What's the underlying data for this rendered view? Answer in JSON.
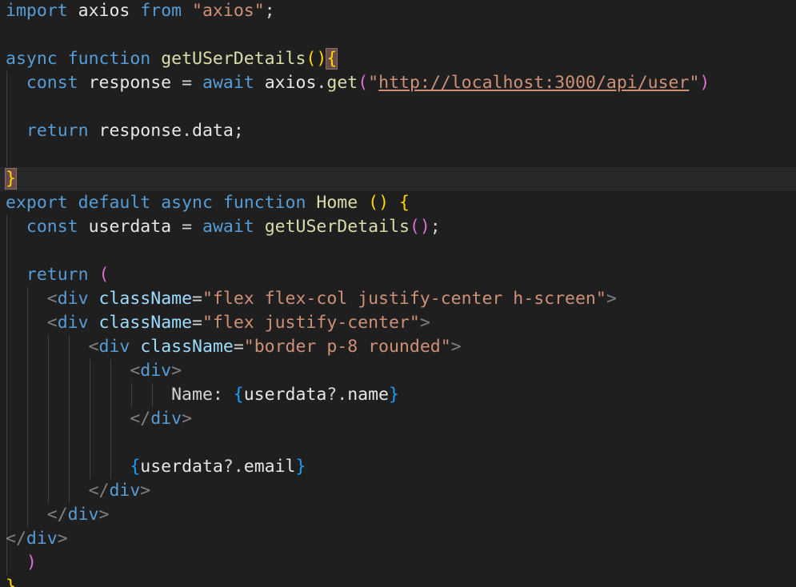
{
  "editor": {
    "lines": [
      [
        {
          "t": "import",
          "c": "kw"
        },
        {
          "t": " "
        },
        {
          "t": "axios",
          "c": "var-white"
        },
        {
          "t": " "
        },
        {
          "t": "from",
          "c": "kw"
        },
        {
          "t": " "
        },
        {
          "t": "\"axios\"",
          "c": "str"
        },
        {
          "t": ";",
          "c": "plain"
        }
      ],
      [],
      [
        {
          "t": "async",
          "c": "kw"
        },
        {
          "t": " "
        },
        {
          "t": "function",
          "c": "kw"
        },
        {
          "t": " "
        },
        {
          "t": "getUSerDetails",
          "c": "fn"
        },
        {
          "t": "()",
          "c": "b1"
        },
        {
          "t": "{",
          "c": "b1 match"
        }
      ],
      [
        {
          "t": "  "
        },
        {
          "t": "const",
          "c": "kw"
        },
        {
          "t": " "
        },
        {
          "t": "response",
          "c": "var-white"
        },
        {
          "t": " "
        },
        {
          "t": "=",
          "c": "plain"
        },
        {
          "t": " "
        },
        {
          "t": "await",
          "c": "kw"
        },
        {
          "t": " "
        },
        {
          "t": "axios",
          "c": "var-white"
        },
        {
          "t": ".",
          "c": "plain"
        },
        {
          "t": "get",
          "c": "fn"
        },
        {
          "t": "(",
          "c": "b2"
        },
        {
          "t": "\"",
          "c": "str"
        },
        {
          "t": "http://localhost:3000/api/user",
          "c": "str link"
        },
        {
          "t": "\"",
          "c": "str"
        },
        {
          "t": ")",
          "c": "b2"
        }
      ],
      [],
      [
        {
          "t": "  "
        },
        {
          "t": "return",
          "c": "kw"
        },
        {
          "t": " "
        },
        {
          "t": "response",
          "c": "var-white"
        },
        {
          "t": ".",
          "c": "plain"
        },
        {
          "t": "data",
          "c": "var-white"
        },
        {
          "t": ";",
          "c": "plain"
        }
      ],
      [],
      [
        {
          "t": "}",
          "c": "b1 match"
        }
      ],
      [
        {
          "t": "export",
          "c": "kw"
        },
        {
          "t": " "
        },
        {
          "t": "default",
          "c": "kw"
        },
        {
          "t": " "
        },
        {
          "t": "async",
          "c": "kw"
        },
        {
          "t": " "
        },
        {
          "t": "function",
          "c": "kw"
        },
        {
          "t": " "
        },
        {
          "t": "Home",
          "c": "fn"
        },
        {
          "t": " "
        },
        {
          "t": "()",
          "c": "b1"
        },
        {
          "t": " "
        },
        {
          "t": "{",
          "c": "b1"
        }
      ],
      [
        {
          "t": "  "
        },
        {
          "t": "const",
          "c": "kw"
        },
        {
          "t": " "
        },
        {
          "t": "userdata",
          "c": "var-white"
        },
        {
          "t": " "
        },
        {
          "t": "=",
          "c": "plain"
        },
        {
          "t": " "
        },
        {
          "t": "await",
          "c": "kw"
        },
        {
          "t": " "
        },
        {
          "t": "getUSerDetails",
          "c": "fn"
        },
        {
          "t": "()",
          "c": "b2"
        },
        {
          "t": ";",
          "c": "plain"
        }
      ],
      [],
      [
        {
          "t": "  "
        },
        {
          "t": "return",
          "c": "kw"
        },
        {
          "t": " "
        },
        {
          "t": "(",
          "c": "b2"
        }
      ],
      [
        {
          "t": "    "
        },
        {
          "t": "<",
          "c": "punc"
        },
        {
          "t": "div",
          "c": "tag"
        },
        {
          "t": " "
        },
        {
          "t": "className",
          "c": "attr"
        },
        {
          "t": "=",
          "c": "plain"
        },
        {
          "t": "\"flex flex-col justify-center h-screen\"",
          "c": "str"
        },
        {
          "t": ">",
          "c": "punc"
        }
      ],
      [
        {
          "t": "    "
        },
        {
          "t": "<",
          "c": "punc"
        },
        {
          "t": "div",
          "c": "tag"
        },
        {
          "t": " "
        },
        {
          "t": "className",
          "c": "attr"
        },
        {
          "t": "=",
          "c": "plain"
        },
        {
          "t": "\"flex justify-center\"",
          "c": "str"
        },
        {
          "t": ">",
          "c": "punc"
        }
      ],
      [
        {
          "t": "        "
        },
        {
          "t": "<",
          "c": "punc"
        },
        {
          "t": "div",
          "c": "tag"
        },
        {
          "t": " "
        },
        {
          "t": "className",
          "c": "attr"
        },
        {
          "t": "=",
          "c": "plain"
        },
        {
          "t": "\"border p-8 rounded\"",
          "c": "str"
        },
        {
          "t": ">",
          "c": "punc"
        }
      ],
      [
        {
          "t": "            "
        },
        {
          "t": "<",
          "c": "punc"
        },
        {
          "t": "div",
          "c": "tag"
        },
        {
          "t": ">",
          "c": "punc"
        }
      ],
      [
        {
          "t": "                "
        },
        {
          "t": "Name: ",
          "c": "jsx-text"
        },
        {
          "t": "{",
          "c": "b3"
        },
        {
          "t": "userdata",
          "c": "var-white"
        },
        {
          "t": "?.",
          "c": "plain"
        },
        {
          "t": "name",
          "c": "var-white"
        },
        {
          "t": "}",
          "c": "b3"
        }
      ],
      [
        {
          "t": "            "
        },
        {
          "t": "</",
          "c": "punc"
        },
        {
          "t": "div",
          "c": "tag"
        },
        {
          "t": ">",
          "c": "punc"
        }
      ],
      [],
      [
        {
          "t": "            "
        },
        {
          "t": "{",
          "c": "b3"
        },
        {
          "t": "userdata",
          "c": "var-white"
        },
        {
          "t": "?.",
          "c": "plain"
        },
        {
          "t": "email",
          "c": "var-white"
        },
        {
          "t": "}",
          "c": "b3"
        }
      ],
      [
        {
          "t": "        "
        },
        {
          "t": "</",
          "c": "punc"
        },
        {
          "t": "div",
          "c": "tag"
        },
        {
          "t": ">",
          "c": "punc"
        }
      ],
      [
        {
          "t": "    "
        },
        {
          "t": "</",
          "c": "punc"
        },
        {
          "t": "div",
          "c": "tag"
        },
        {
          "t": ">",
          "c": "punc"
        }
      ],
      [
        {
          "t": "</",
          "c": "punc"
        },
        {
          "t": "div",
          "c": "tag"
        },
        {
          "t": ">",
          "c": "punc"
        }
      ],
      [
        {
          "t": "  "
        },
        {
          "t": ")",
          "c": "b2"
        }
      ],
      [
        {
          "t": "}",
          "c": "b1"
        }
      ]
    ]
  }
}
